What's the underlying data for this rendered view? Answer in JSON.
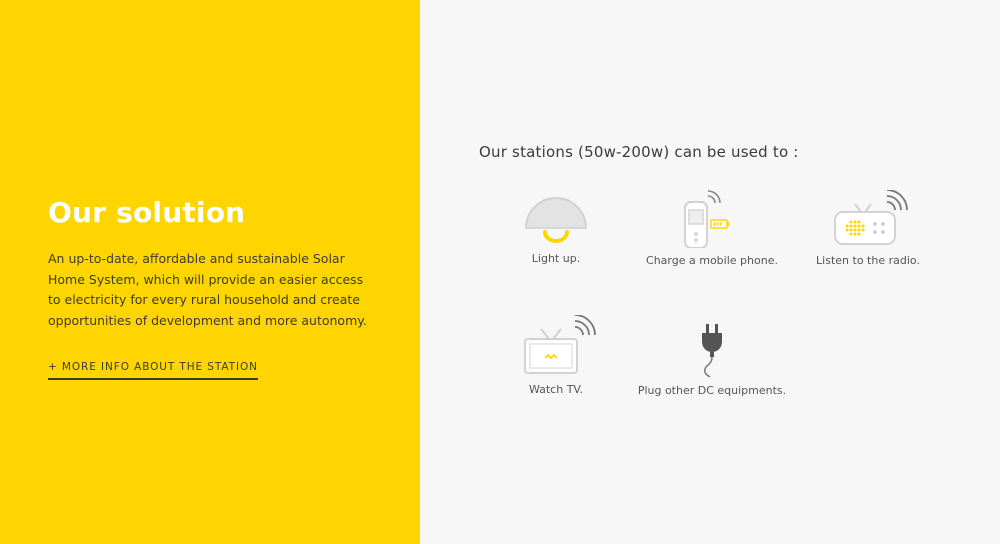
{
  "solution": {
    "title": "Our solution",
    "description": "An up-to-date, affordable and sustainable Solar Home System, which will provide an easier access to electricity for every rural household and create opportunities of development and more autonomy.",
    "more_link": "+ MORE INFO ABOUT THE STATION"
  },
  "stations": {
    "heading": "Our stations (50w-200w) can be used to :",
    "features": [
      {
        "icon": "lamp-icon",
        "label": "Light up."
      },
      {
        "icon": "mobile-phone-icon",
        "label": "Charge a mobile phone."
      },
      {
        "icon": "radio-icon",
        "label": "Listen to the radio."
      },
      {
        "icon": "tv-icon",
        "label": "Watch TV."
      },
      {
        "icon": "plug-icon",
        "label": "Plug other DC equipments."
      }
    ]
  },
  "colors": {
    "brand_yellow": "#ffd500",
    "panel_gray": "#f7f7f7",
    "text_dark": "#3b3b3b",
    "icon_gray": "#d9d9d9"
  }
}
